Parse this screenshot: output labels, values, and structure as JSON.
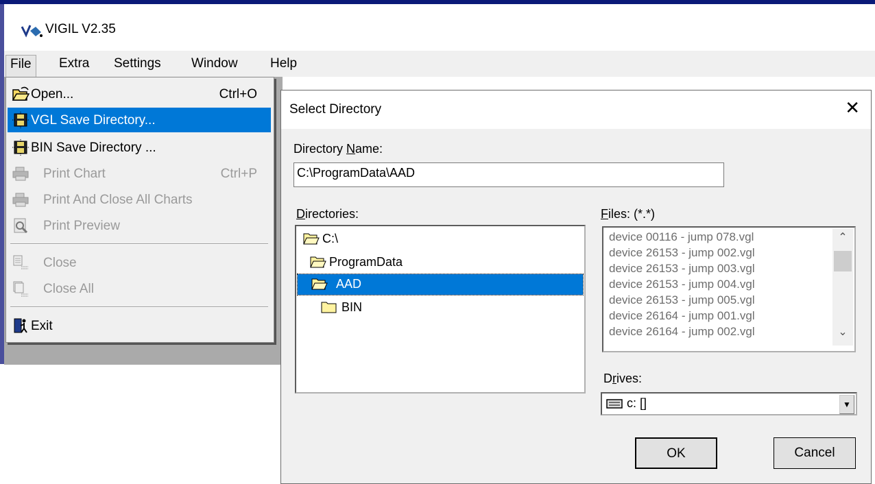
{
  "app": {
    "title": "VIGIL  V2.35"
  },
  "menubar": {
    "items": [
      "File",
      "Extra",
      "Settings",
      "Window",
      "Help"
    ]
  },
  "file_menu": {
    "items": [
      {
        "label": "Open...",
        "shortcut": "Ctrl+O",
        "icon": "open-folder-icon",
        "state": "enabled"
      },
      {
        "label": "VGL Save Directory...",
        "shortcut": "",
        "icon": "save-directory-icon",
        "state": "selected"
      },
      {
        "label": "BIN Save Directory ...",
        "shortcut": "",
        "icon": "save-directory-icon",
        "state": "enabled"
      },
      {
        "label": "Print Chart",
        "shortcut": "Ctrl+P",
        "icon": "printer-icon",
        "state": "disabled"
      },
      {
        "label": "Print And Close All Charts",
        "shortcut": "",
        "icon": "printer-icon",
        "state": "disabled"
      },
      {
        "label": "Print Preview",
        "shortcut": "",
        "icon": "print-preview-icon",
        "state": "disabled"
      },
      {
        "label": "Close",
        "shortcut": "",
        "icon": "close-window-icon",
        "state": "disabled"
      },
      {
        "label": "Close All",
        "shortcut": "",
        "icon": "close-all-icon",
        "state": "disabled"
      },
      {
        "label": "Exit",
        "shortcut": "",
        "icon": "exit-door-icon",
        "state": "enabled"
      }
    ]
  },
  "dialog": {
    "title": "Select Directory",
    "close_glyph": "✕",
    "dirname_label_pre": "Directory ",
    "dirname_label_u": "N",
    "dirname_label_post": "ame:",
    "dirname_value": "C:\\ProgramData\\AAD",
    "directories_label_u": "D",
    "directories_label_post": "irectories:",
    "directories": [
      "C:\\",
      "ProgramData",
      "AAD",
      "BIN"
    ],
    "files_label_u": "F",
    "files_label_post": "iles: (*.*)",
    "files": [
      "device 00116 - jump 078.vgl",
      "device 26153 - jump 002.vgl",
      "device 26153 - jump 003.vgl",
      "device 26153 - jump 004.vgl",
      "device 26153 - jump 005.vgl",
      "device 26164 - jump 001.vgl",
      "device 26164 - jump 002.vgl"
    ],
    "drives_label_pre": "D",
    "drives_label_u": "r",
    "drives_label_post": "ives:",
    "drive_value": "c: []",
    "ok_label": "OK",
    "cancel_label": "Cancel"
  },
  "colors": {
    "selection": "#0078d7",
    "title_accent": "#0a1a78",
    "workspace": "#aaaaaa"
  }
}
